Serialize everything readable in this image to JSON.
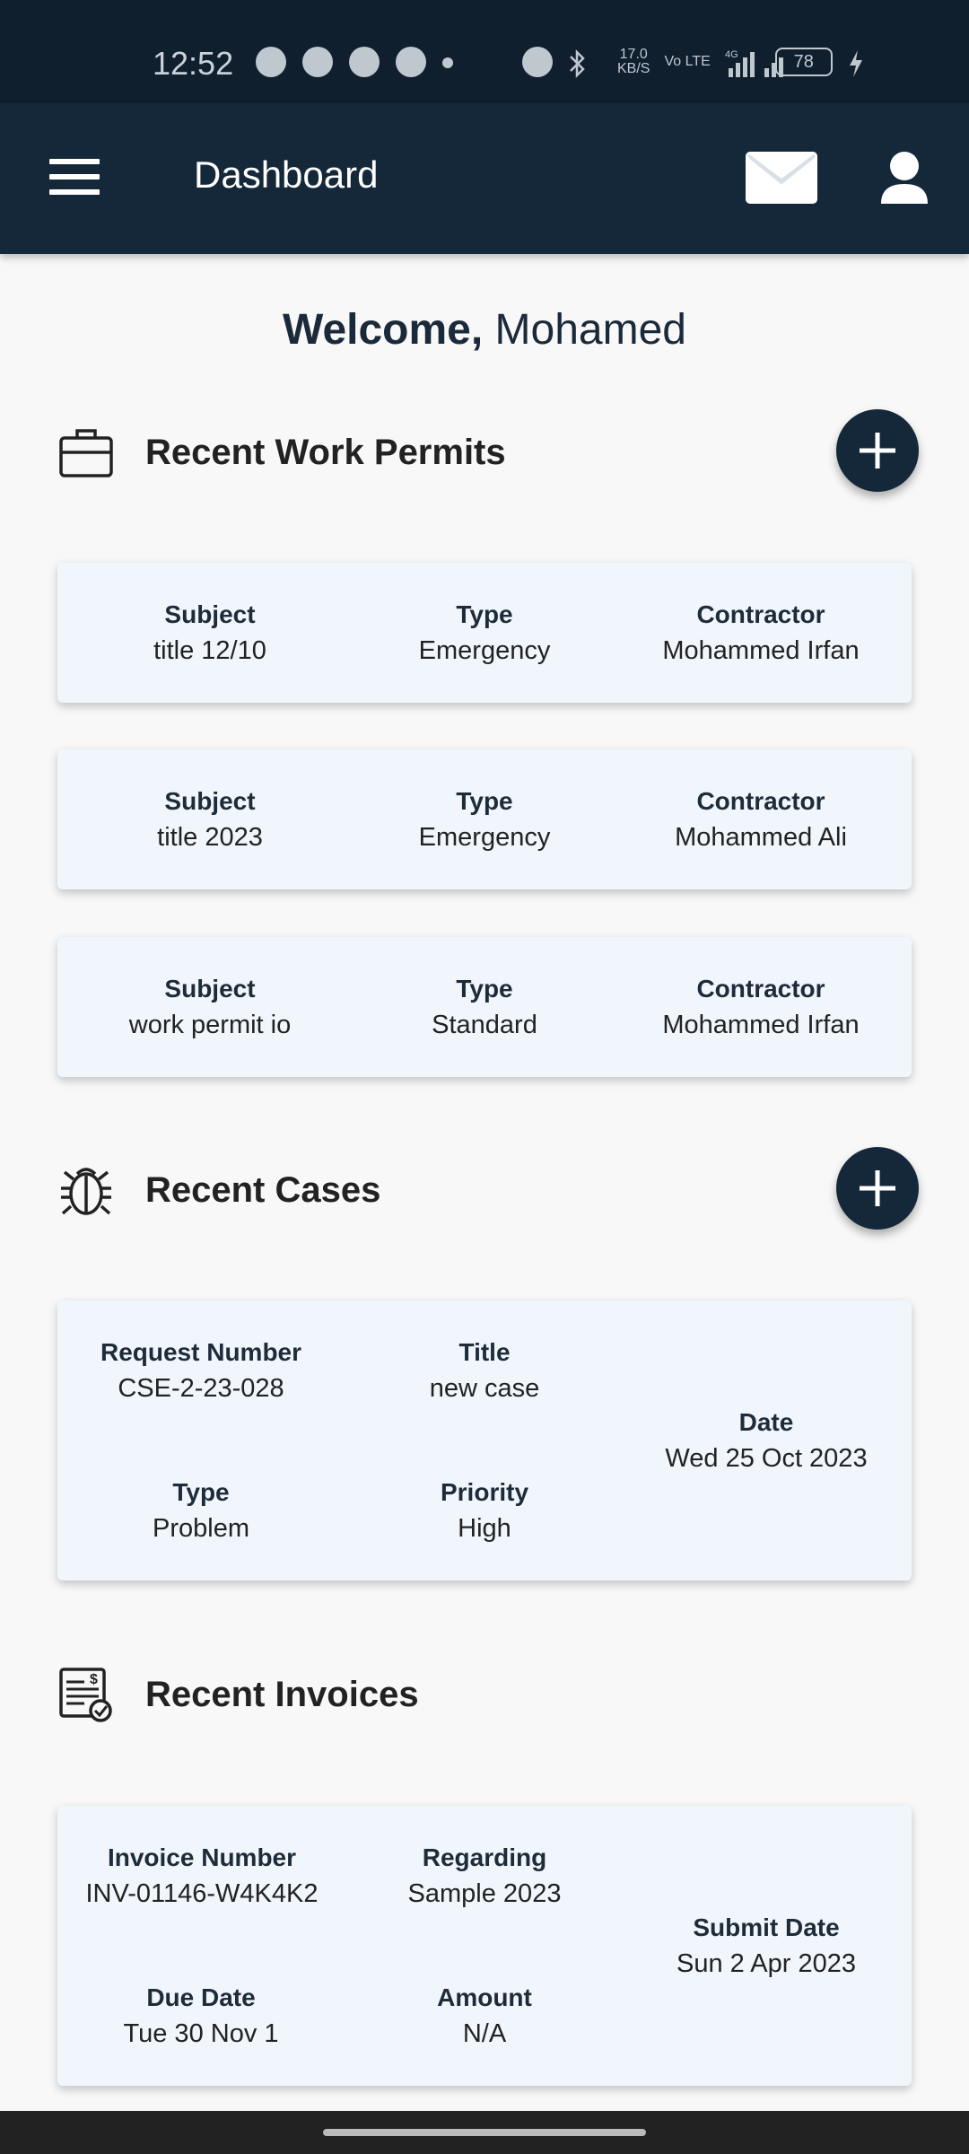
{
  "status_bar": {
    "time": "12:52",
    "net_speed_value": "17.0",
    "net_speed_unit": "KB/S",
    "volte": "Vo LTE",
    "network": "4G",
    "battery": "78"
  },
  "app_bar": {
    "title": "Dashboard"
  },
  "welcome": {
    "greeting": "Welcome,",
    "name": "Mohamed"
  },
  "work_permits": {
    "title": "Recent Work Permits",
    "labels": {
      "subject": "Subject",
      "type": "Type",
      "contractor": "Contractor"
    },
    "items": [
      {
        "subject": "title 12/10",
        "type": "Emergency",
        "contractor": "Mohammed Irfan"
      },
      {
        "subject": "title 2023",
        "type": "Emergency",
        "contractor": "Mohammed Ali"
      },
      {
        "subject": "work permit io",
        "type": "Standard",
        "contractor": "Mohammed Irfan"
      }
    ]
  },
  "cases": {
    "title": "Recent Cases",
    "labels": {
      "request_number": "Request Number",
      "title": "Title",
      "date": "Date",
      "type": "Type",
      "priority": "Priority"
    },
    "items": [
      {
        "request_number": "CSE-2-23-028",
        "title": "new case",
        "date": "Wed 25 Oct 2023",
        "type": "Problem",
        "priority": "High"
      }
    ]
  },
  "invoices": {
    "title": "Recent Invoices",
    "labels": {
      "invoice_number": "Invoice Number",
      "regarding": "Regarding",
      "submit_date": "Submit Date",
      "due_date": "Due Date",
      "amount": "Amount"
    },
    "items": [
      {
        "invoice_number": "INV-01146-W4K4K2",
        "regarding": "Sample 2023",
        "submit_date": "Sun 2 Apr 2023",
        "due_date": "Tue 30 Nov 1",
        "amount": "N/A"
      }
    ]
  },
  "colors": {
    "app_bar": "#14283a",
    "card_background": "#f1f5fc",
    "fab": "#14283a"
  },
  "icons": {
    "menu": "hamburger-menu-icon",
    "mail": "mail-icon",
    "profile": "profile-icon",
    "work_permits": "briefcase-icon",
    "cases": "bug-icon",
    "invoices": "invoice-icon",
    "add": "plus-icon"
  }
}
